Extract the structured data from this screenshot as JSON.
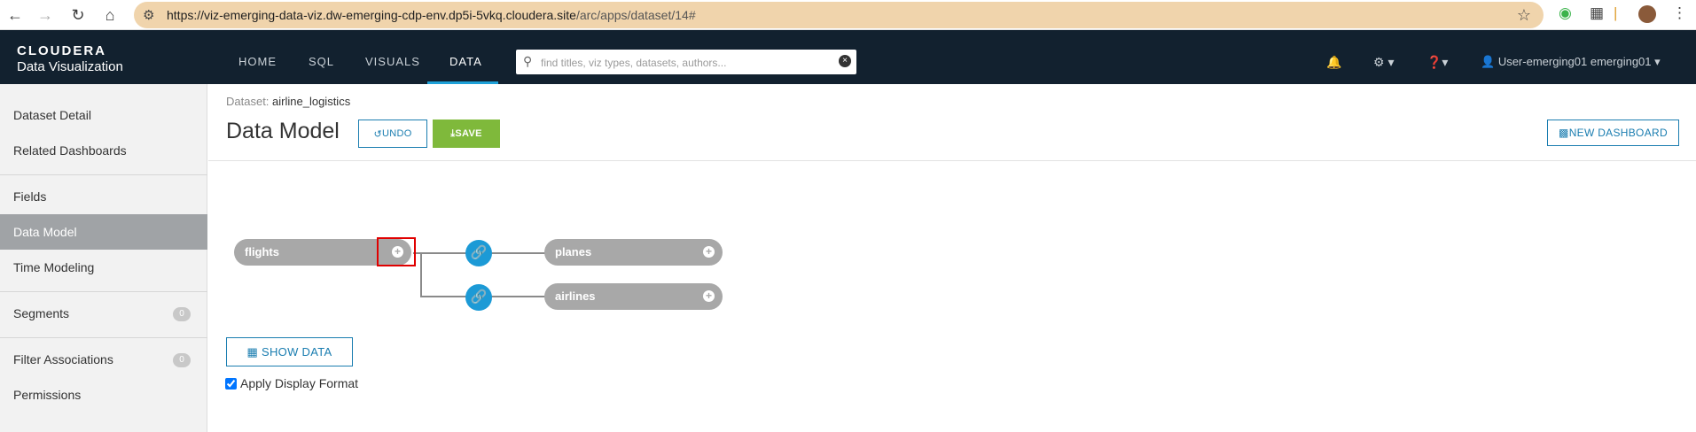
{
  "browser": {
    "url_main": "https://viz-emerging-data-viz.dw-emerging-cdp-env.dp5i-5vkq.cloudera.site",
    "url_path": "/arc/apps/dataset/14#"
  },
  "brand": {
    "line1": "CLOUDERA",
    "line2": "Data Visualization"
  },
  "nav": {
    "home": "HOME",
    "sql": "SQL",
    "visuals": "VISUALS",
    "data": "DATA"
  },
  "search": {
    "placeholder": "find titles, viz types, datasets, authors..."
  },
  "user": {
    "name": "User-emerging01 emerging01"
  },
  "sidebar": {
    "items": [
      {
        "label": "Dataset Detail"
      },
      {
        "label": "Related Dashboards"
      },
      {
        "label": "Fields"
      },
      {
        "label": "Data Model"
      },
      {
        "label": "Time Modeling"
      },
      {
        "label": "Segments",
        "count": "0"
      },
      {
        "label": "Filter Associations",
        "count": "0"
      },
      {
        "label": "Permissions"
      }
    ]
  },
  "header": {
    "dataset_label": "Dataset:",
    "dataset_name": "airline_logistics",
    "title": "Data Model",
    "undo": "UNDO",
    "save": "SAVE",
    "new_dashboard": "NEW DASHBOARD"
  },
  "model": {
    "root": "flights",
    "joins": [
      {
        "table": "planes"
      },
      {
        "table": "airlines"
      }
    ]
  },
  "actions": {
    "show_data": "SHOW DATA",
    "apply_format": "Apply Display Format"
  },
  "colors": {
    "nav_bg": "#12212f",
    "accent": "#1c9ad6",
    "save": "#7fb93b",
    "highlight": "#e00000"
  }
}
